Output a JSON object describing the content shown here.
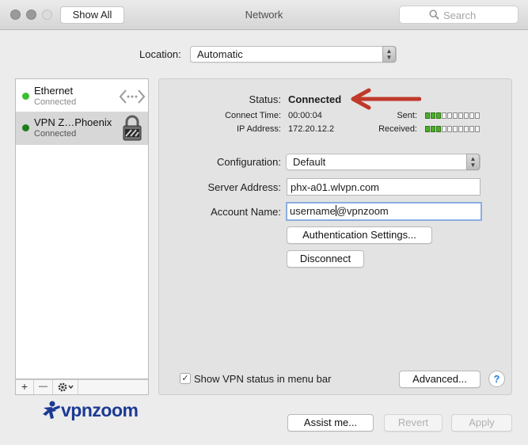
{
  "window": {
    "title": "Network",
    "show_all_label": "Show All",
    "search_placeholder": "Search"
  },
  "location": {
    "label": "Location:",
    "value": "Automatic"
  },
  "services": [
    {
      "name": "Ethernet",
      "status": "Connected",
      "dot_color": "#3bbf2e",
      "icon": "ethernet-arrows-icon",
      "selected": false
    },
    {
      "name": "VPN Z…Phoenix",
      "status": "Connected",
      "dot_color": "#1a7f1a",
      "icon": "vpn-lock-icon",
      "selected": true
    }
  ],
  "sidebar_toolbar": {
    "add": "+",
    "remove": "—",
    "actions_icon": "gear-icon"
  },
  "detail": {
    "status_label": "Status:",
    "status_value": "Connected",
    "connect_time_label": "Connect Time:",
    "connect_time_value": "00:00:04",
    "ip_label": "IP Address:",
    "ip_value": "172.20.12.2",
    "sent_label": "Sent:",
    "received_label": "Received:",
    "configuration_label": "Configuration:",
    "configuration_value": "Default",
    "server_label": "Server Address:",
    "server_value": "phx-a01.wlvpn.com",
    "account_label": "Account Name:",
    "account_value_before_caret": "username",
    "account_value_after_caret": "@vpnzoom",
    "auth_button": "Authentication Settings...",
    "disconnect_button": "Disconnect",
    "show_vpn_label": "Show VPN status in menu bar",
    "show_vpn_checked": true,
    "advanced_button": "Advanced...",
    "help": "?"
  },
  "logo": {
    "text": "vpnzoom"
  },
  "footer": {
    "assist_button": "Assist me...",
    "revert_button": "Revert",
    "apply_button": "Apply"
  },
  "colors": {
    "annotation_arrow": "#c0392b",
    "meter_on": "#4faa2c",
    "logo_blue": "#1b3a94"
  }
}
